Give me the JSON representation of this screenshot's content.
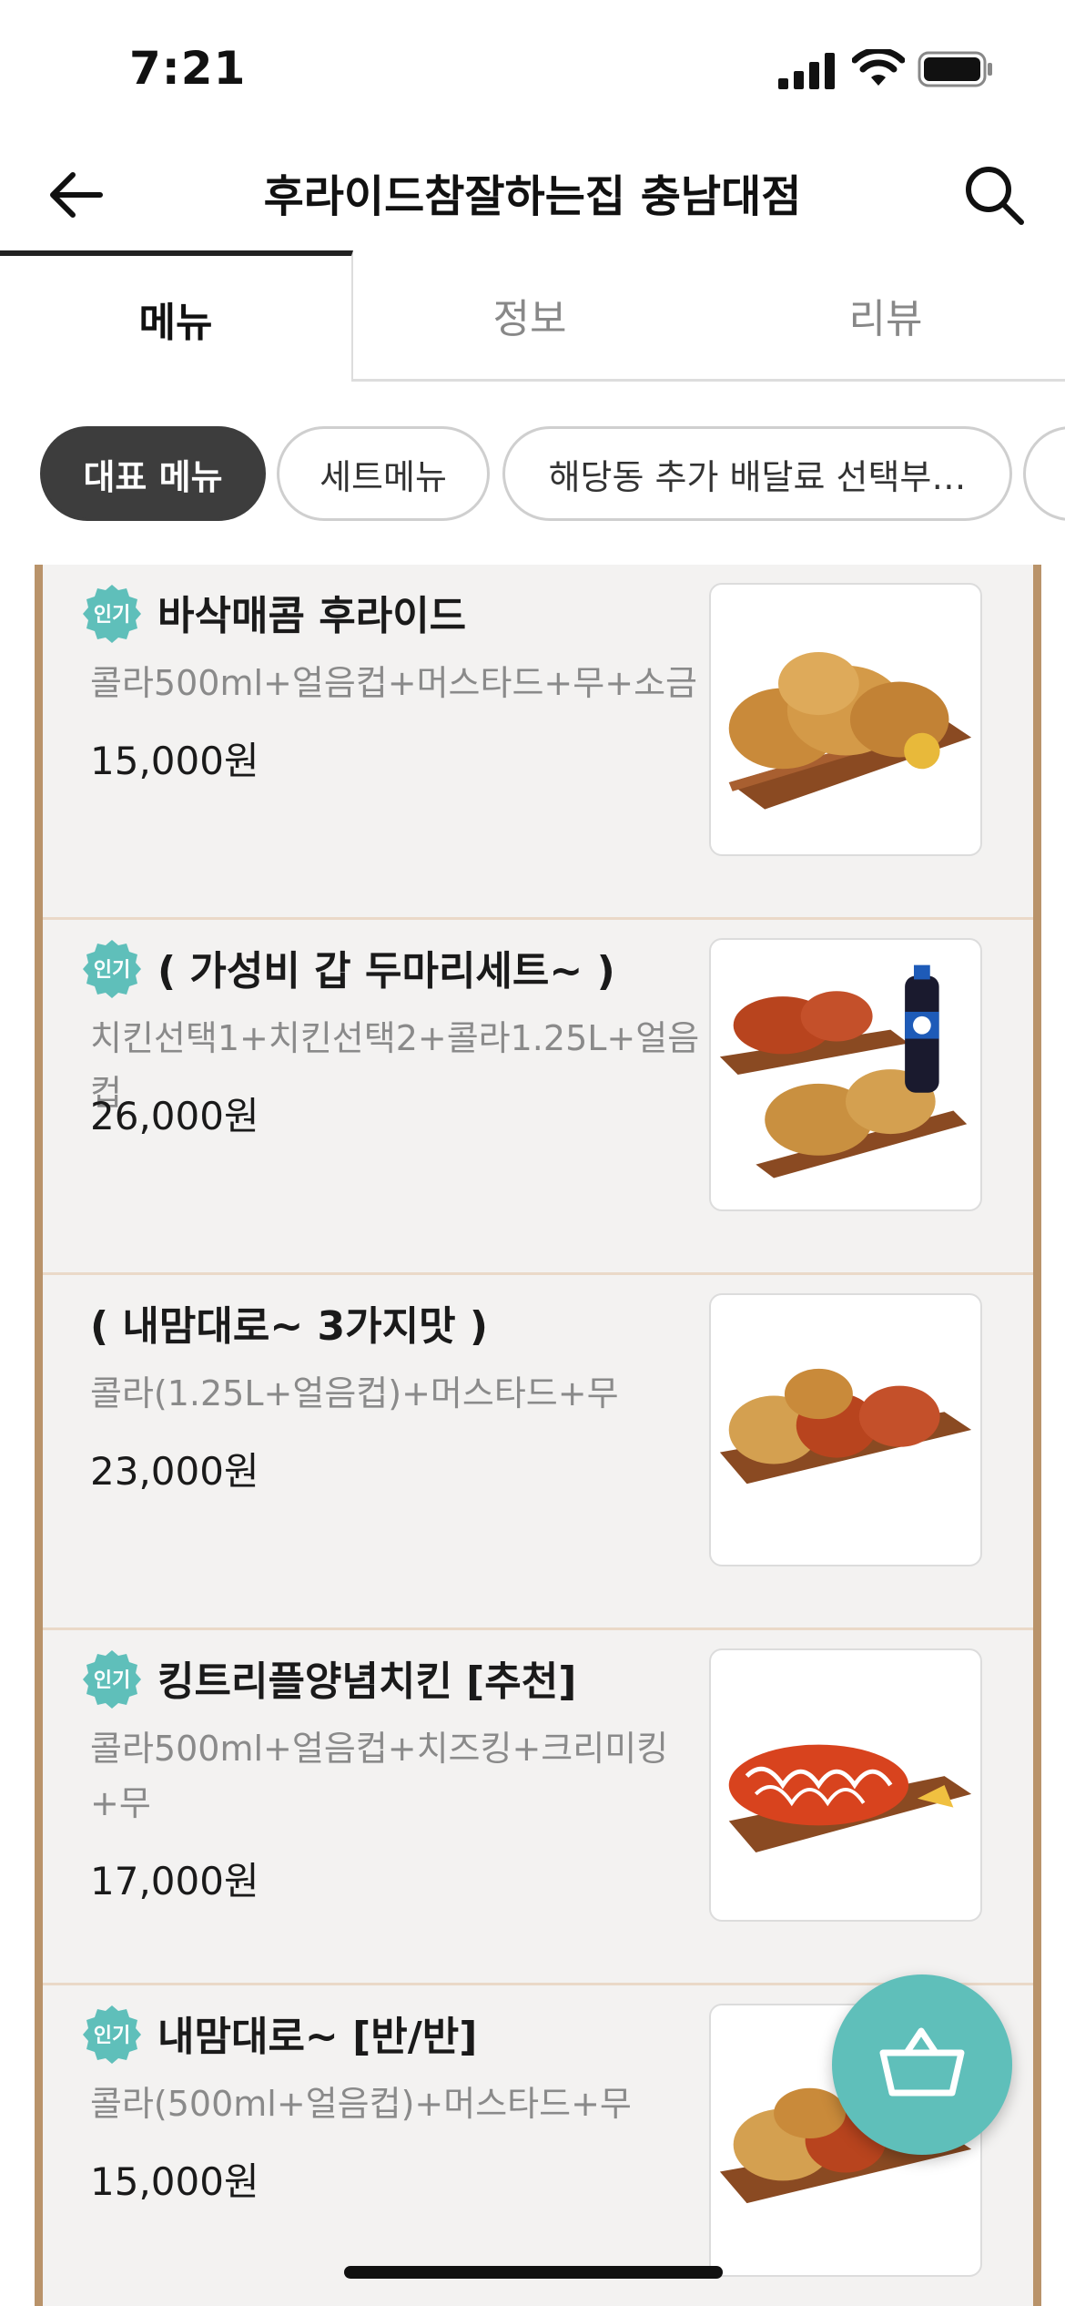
{
  "status_bar": {
    "time": "7:21"
  },
  "header": {
    "title": "후라이드참잘하는집 충남대점"
  },
  "tabs": [
    {
      "label": "메뉴",
      "active": true
    },
    {
      "label": "정보",
      "active": false
    },
    {
      "label": "리뷰",
      "active": false
    }
  ],
  "chips": [
    {
      "label": "대표 메뉴",
      "active": true
    },
    {
      "label": "세트메뉴",
      "active": false
    },
    {
      "label": "해당동 추가 배달료 선택부…",
      "active": false
    },
    {
      "label": "",
      "active": false
    }
  ],
  "badge_label": "인기",
  "menu_items": [
    {
      "name": "바삭매콤 후라이드",
      "popular": true,
      "desc": "콜라500ml+얼음컵+머스타드+무+소금",
      "price": "15,000원"
    },
    {
      "name": "( 가성비 갑 두마리세트~ )",
      "popular": true,
      "desc": "치킨선택1+치킨선택2+콜라1.25L+얼음컵",
      "price": "26,000원"
    },
    {
      "name": "( 내맘대로~ 3가지맛 )",
      "popular": false,
      "desc": "콜라(1.25L+얼음컵)+머스타드+무",
      "price": "23,000원"
    },
    {
      "name": "킹트리플양념치킨 [추천]",
      "popular": true,
      "desc": "콜라500ml+얼음컵+치즈킹+크리미킹+무",
      "price": "17,000원"
    },
    {
      "name": "내맘대로~ [반/반]",
      "popular": true,
      "desc": "콜라(500ml+얼음컵)+머스타드+무",
      "price": "15,000원"
    }
  ],
  "colors": {
    "accent": "#5fbfba",
    "border_wood": "#b9936a",
    "chip_active": "#3d3d3d"
  }
}
